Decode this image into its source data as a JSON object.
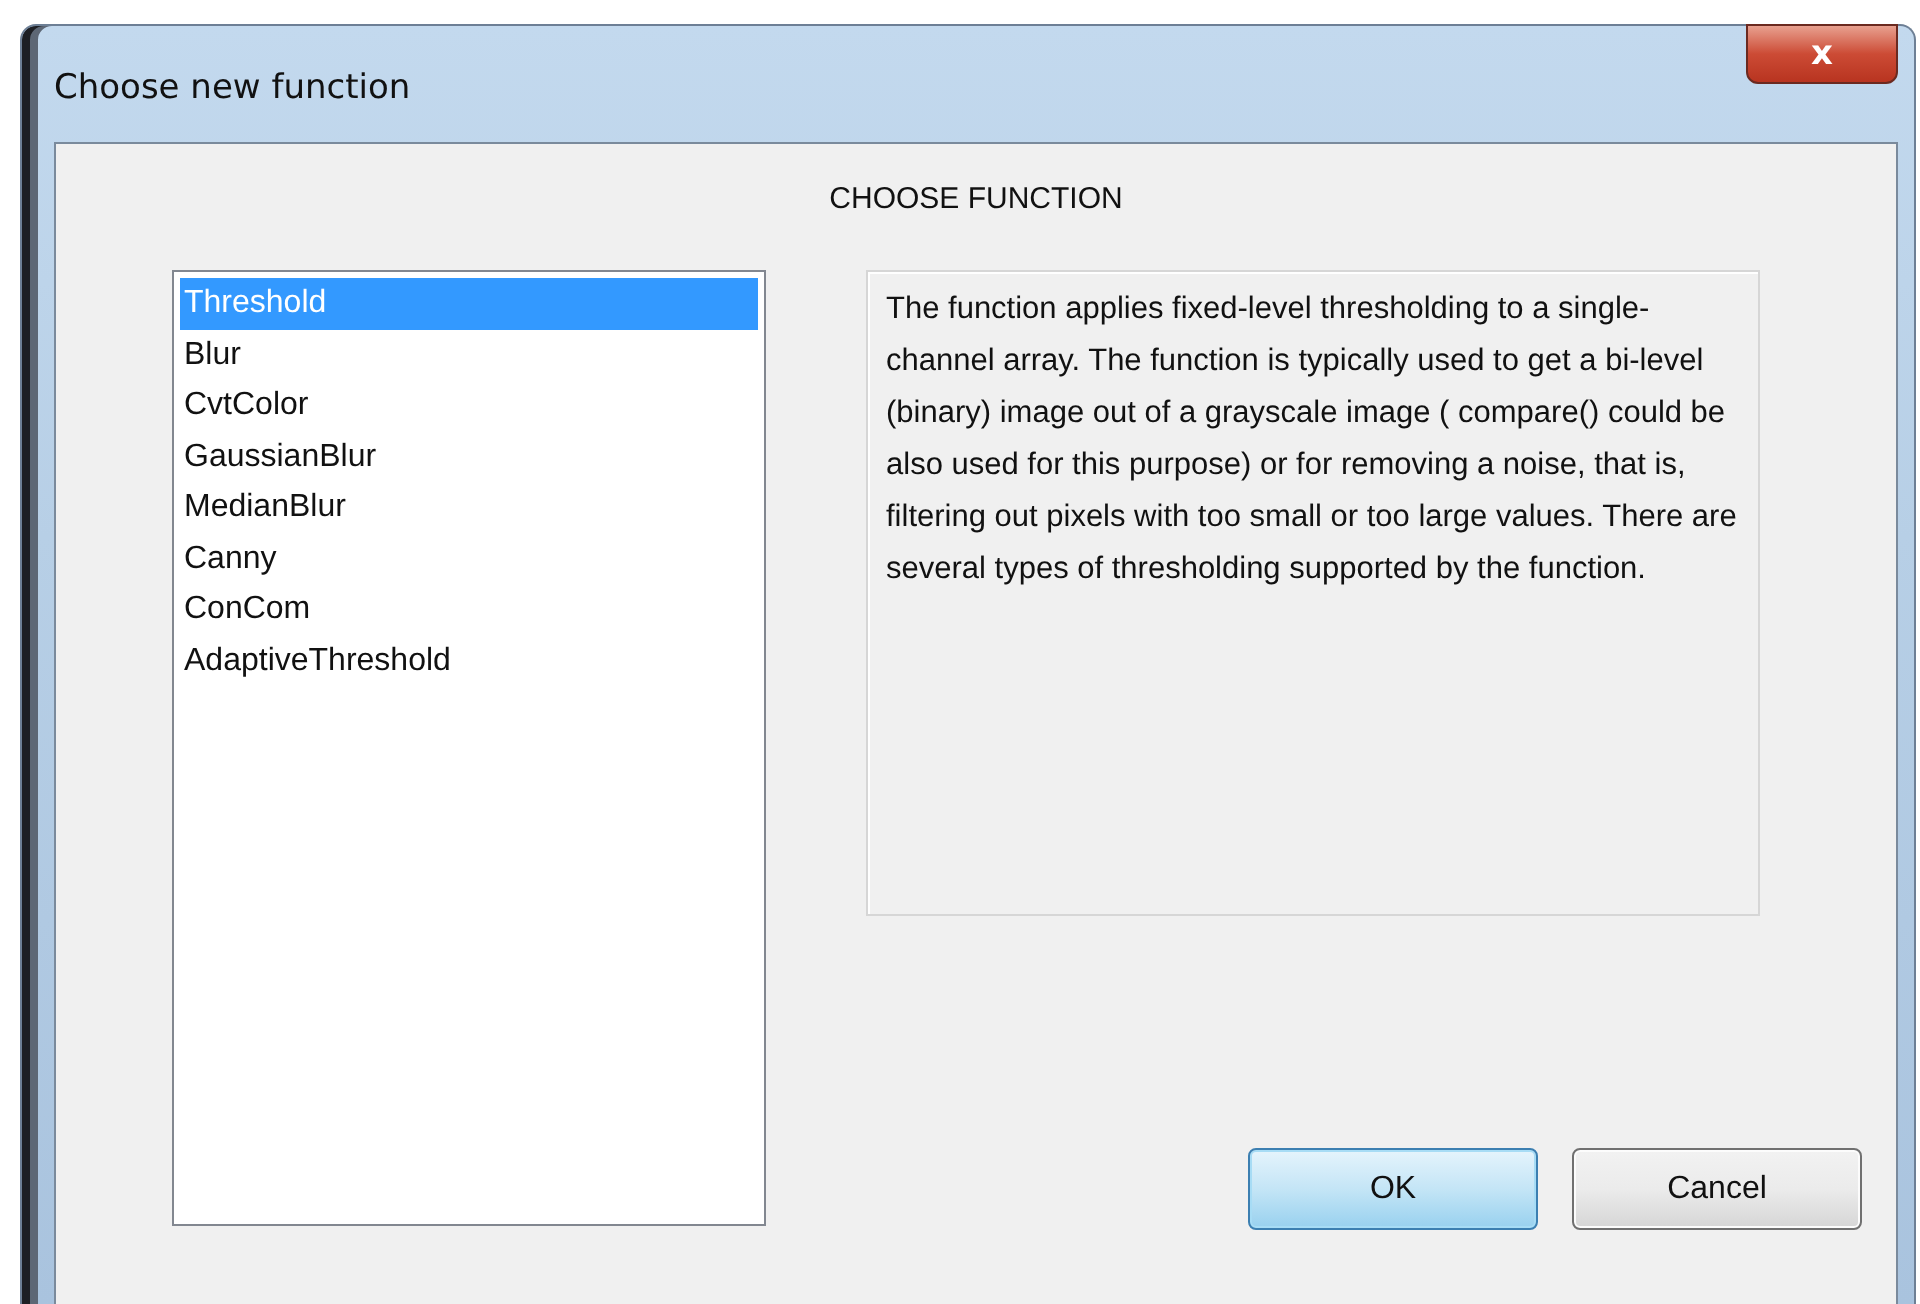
{
  "window": {
    "title": "Choose new function",
    "close_label": "x"
  },
  "heading": "CHOOSE FUNCTION",
  "functions": [
    {
      "label": "Threshold",
      "selected": true
    },
    {
      "label": "Blur",
      "selected": false
    },
    {
      "label": "CvtColor",
      "selected": false
    },
    {
      "label": "GaussianBlur",
      "selected": false
    },
    {
      "label": "MedianBlur",
      "selected": false
    },
    {
      "label": "Canny",
      "selected": false
    },
    {
      "label": "ConCom",
      "selected": false
    },
    {
      "label": "AdaptiveThreshold",
      "selected": false
    }
  ],
  "description": "The function applies fixed-level thresholding to a single-channel array. The function is typically used to get a bi-level (binary) image out of a grayscale image ( compare() could be also used for this purpose) or for removing a noise, that is, filtering out pixels with too small or too large values. There are several types of thresholding supported by the function.",
  "buttons": [
    {
      "label": "OK",
      "kind": "default"
    },
    {
      "label": "Cancel",
      "kind": "normal"
    }
  ]
}
